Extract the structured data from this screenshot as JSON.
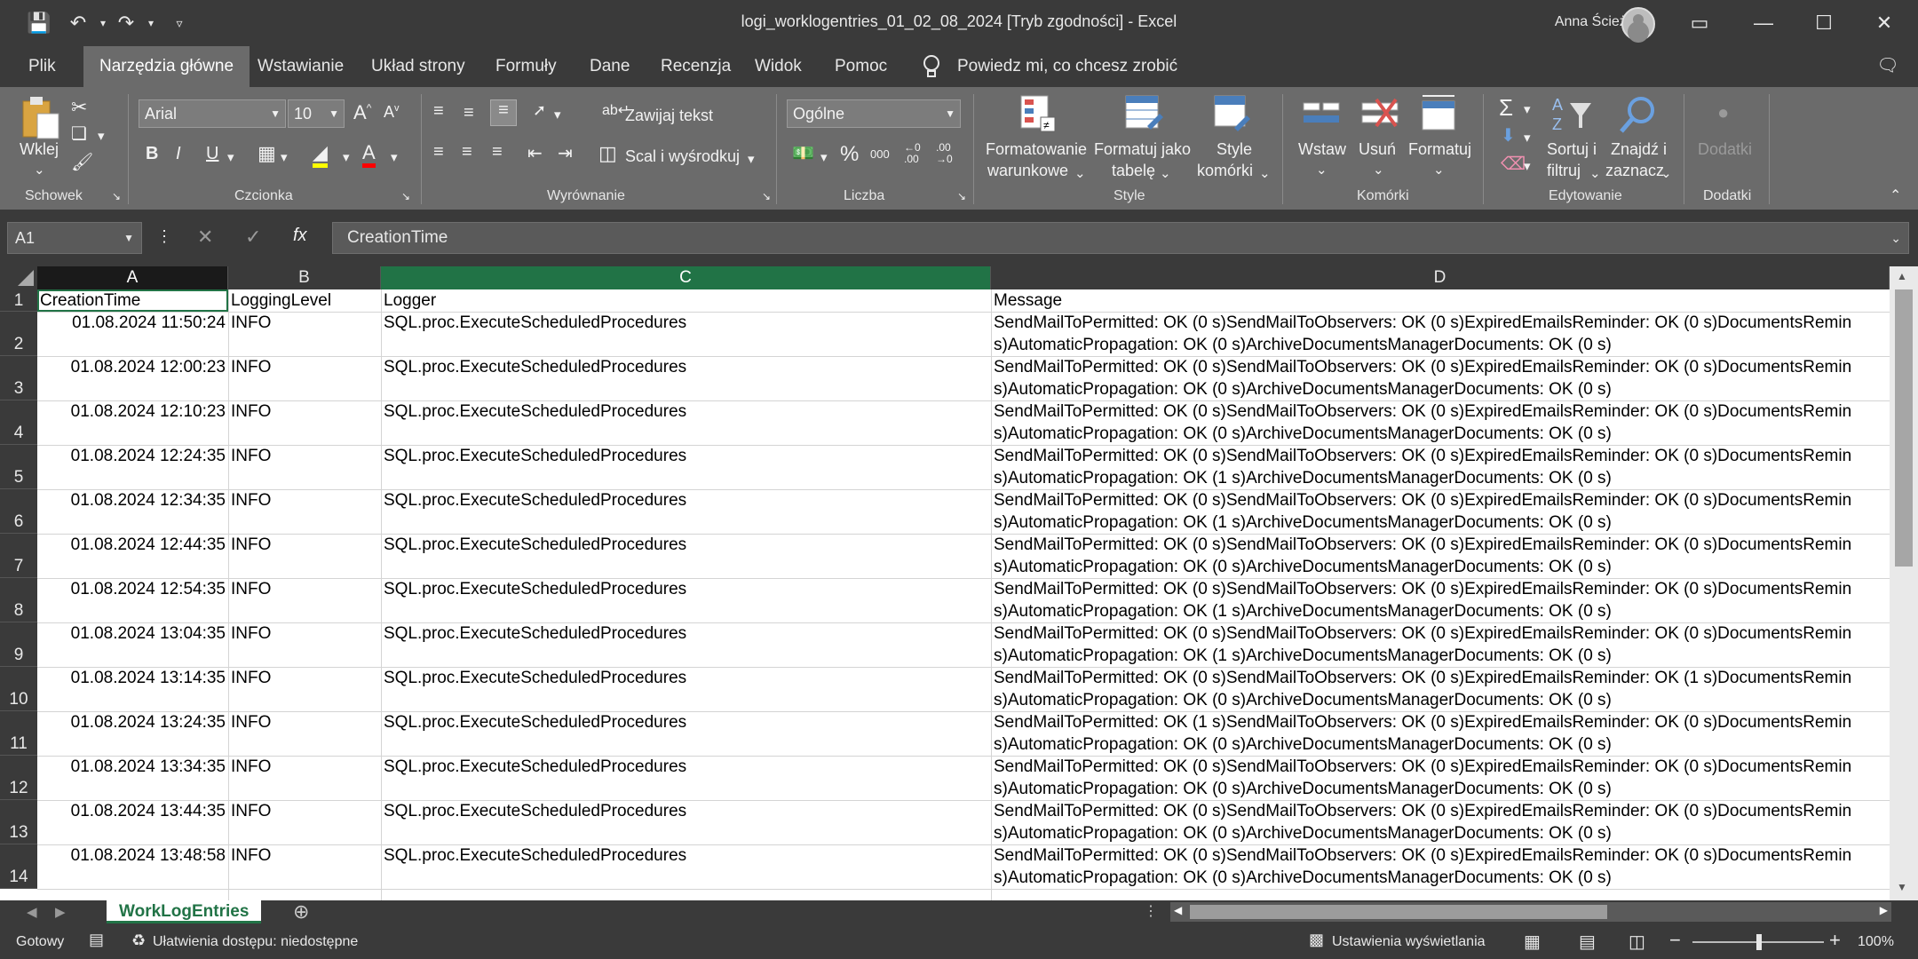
{
  "titlebar": {
    "title": "logi_worklogentries_01_02_08_2024  [Tryb zgodności]  -  Excel",
    "user": "Anna Ścieżor"
  },
  "tabs": [
    "Plik",
    "Narzędzia główne",
    "Wstawianie",
    "Układ strony",
    "Formuły",
    "Dane",
    "Recenzja",
    "Widok",
    "Pomoc"
  ],
  "tell_me": "Powiedz mi, co chcesz zrobić",
  "ribbon": {
    "clipboard": {
      "paste": "Wklej",
      "group": "Schowek"
    },
    "font": {
      "name": "Arial",
      "size": "10",
      "bold": "B",
      "italic": "I",
      "underline": "U",
      "group": "Czcionka"
    },
    "alignment": {
      "wrap": "Zawijaj tekst",
      "merge": "Scal i wyśrodkuj",
      "group": "Wyrównanie"
    },
    "number": {
      "format": "Ogólne",
      "group": "Liczba"
    },
    "styles": {
      "conditional_line1": "Formatowanie",
      "conditional_line2": "warunkowe",
      "table_line1": "Formatuj jako",
      "table_line2": "tabelę",
      "cell_line1": "Style",
      "cell_line2": "komórki",
      "group": "Style"
    },
    "cells": {
      "insert": "Wstaw",
      "delete": "Usuń",
      "format": "Formatuj",
      "group": "Komórki"
    },
    "editing": {
      "sort_line1": "Sortuj i",
      "sort_line2": "filtruj",
      "find_line1": "Znajdź i",
      "find_line2": "zaznacz",
      "group": "Edytowanie"
    },
    "addins": {
      "button": "Dodatki",
      "group": "Dodatki"
    }
  },
  "formula_bar": {
    "name_box": "A1",
    "content": "CreationTime"
  },
  "columns": [
    "A",
    "B",
    "C",
    "D"
  ],
  "header_row": [
    "CreationTime",
    "LoggingLevel",
    "Logger",
    "Message"
  ],
  "rows": [
    {
      "num": "2",
      "time": "01.08.2024 11:50:24",
      "level": "INFO",
      "logger": "SQL.proc.ExecuteScheduledProcedures",
      "msg1": "SendMailToPermitted: OK (0 s)SendMailToObservers: OK (0 s)ExpiredEmailsReminder: OK (0 s)DocumentsRemin",
      "msg2": "s)AutomaticPropagation: OK (0 s)ArchiveDocumentsManagerDocuments: OK (0 s)"
    },
    {
      "num": "3",
      "time": "01.08.2024 12:00:23",
      "level": "INFO",
      "logger": "SQL.proc.ExecuteScheduledProcedures",
      "msg1": "SendMailToPermitted: OK (0 s)SendMailToObservers: OK (0 s)ExpiredEmailsReminder: OK (0 s)DocumentsRemin",
      "msg2": "s)AutomaticPropagation: OK (0 s)ArchiveDocumentsManagerDocuments: OK (0 s)"
    },
    {
      "num": "4",
      "time": "01.08.2024 12:10:23",
      "level": "INFO",
      "logger": "SQL.proc.ExecuteScheduledProcedures",
      "msg1": "SendMailToPermitted: OK (0 s)SendMailToObservers: OK (0 s)ExpiredEmailsReminder: OK (0 s)DocumentsRemin",
      "msg2": "s)AutomaticPropagation: OK (0 s)ArchiveDocumentsManagerDocuments: OK (0 s)"
    },
    {
      "num": "5",
      "time": "01.08.2024 12:24:35",
      "level": "INFO",
      "logger": "SQL.proc.ExecuteScheduledProcedures",
      "msg1": "SendMailToPermitted: OK (0 s)SendMailToObservers: OK (0 s)ExpiredEmailsReminder: OK (0 s)DocumentsRemin",
      "msg2": "s)AutomaticPropagation: OK (1 s)ArchiveDocumentsManagerDocuments: OK (0 s)"
    },
    {
      "num": "6",
      "time": "01.08.2024 12:34:35",
      "level": "INFO",
      "logger": "SQL.proc.ExecuteScheduledProcedures",
      "msg1": "SendMailToPermitted: OK (0 s)SendMailToObservers: OK (0 s)ExpiredEmailsReminder: OK (0 s)DocumentsRemin",
      "msg2": "s)AutomaticPropagation: OK (1 s)ArchiveDocumentsManagerDocuments: OK (0 s)"
    },
    {
      "num": "7",
      "time": "01.08.2024 12:44:35",
      "level": "INFO",
      "logger": "SQL.proc.ExecuteScheduledProcedures",
      "msg1": "SendMailToPermitted: OK (0 s)SendMailToObservers: OK (0 s)ExpiredEmailsReminder: OK (0 s)DocumentsRemin",
      "msg2": "s)AutomaticPropagation: OK (0 s)ArchiveDocumentsManagerDocuments: OK (0 s)"
    },
    {
      "num": "8",
      "time": "01.08.2024 12:54:35",
      "level": "INFO",
      "logger": "SQL.proc.ExecuteScheduledProcedures",
      "msg1": "SendMailToPermitted: OK (0 s)SendMailToObservers: OK (0 s)ExpiredEmailsReminder: OK (0 s)DocumentsRemin",
      "msg2": "s)AutomaticPropagation: OK (1 s)ArchiveDocumentsManagerDocuments: OK (0 s)"
    },
    {
      "num": "9",
      "time": "01.08.2024 13:04:35",
      "level": "INFO",
      "logger": "SQL.proc.ExecuteScheduledProcedures",
      "msg1": "SendMailToPermitted: OK (0 s)SendMailToObservers: OK (0 s)ExpiredEmailsReminder: OK (0 s)DocumentsRemin",
      "msg2": "s)AutomaticPropagation: OK (1 s)ArchiveDocumentsManagerDocuments: OK (0 s)"
    },
    {
      "num": "10",
      "time": "01.08.2024 13:14:35",
      "level": "INFO",
      "logger": "SQL.proc.ExecuteScheduledProcedures",
      "msg1": "SendMailToPermitted: OK (0 s)SendMailToObservers: OK (0 s)ExpiredEmailsReminder: OK (1 s)DocumentsRemin",
      "msg2": "s)AutomaticPropagation: OK (0 s)ArchiveDocumentsManagerDocuments: OK (0 s)"
    },
    {
      "num": "11",
      "time": "01.08.2024 13:24:35",
      "level": "INFO",
      "logger": "SQL.proc.ExecuteScheduledProcedures",
      "msg1": "SendMailToPermitted: OK (1 s)SendMailToObservers: OK (0 s)ExpiredEmailsReminder: OK (0 s)DocumentsRemin",
      "msg2": "s)AutomaticPropagation: OK (0 s)ArchiveDocumentsManagerDocuments: OK (0 s)"
    },
    {
      "num": "12",
      "time": "01.08.2024 13:34:35",
      "level": "INFO",
      "logger": "SQL.proc.ExecuteScheduledProcedures",
      "msg1": "SendMailToPermitted: OK (0 s)SendMailToObservers: OK (0 s)ExpiredEmailsReminder: OK (0 s)DocumentsRemin",
      "msg2": "s)AutomaticPropagation: OK (0 s)ArchiveDocumentsManagerDocuments: OK (0 s)"
    },
    {
      "num": "13",
      "time": "01.08.2024 13:44:35",
      "level": "INFO",
      "logger": "SQL.proc.ExecuteScheduledProcedures",
      "msg1": "SendMailToPermitted: OK (0 s)SendMailToObservers: OK (0 s)ExpiredEmailsReminder: OK (0 s)DocumentsRemin",
      "msg2": "s)AutomaticPropagation: OK (0 s)ArchiveDocumentsManagerDocuments: OK (0 s)"
    },
    {
      "num": "14",
      "time": "01.08.2024 13:48:58",
      "level": "INFO",
      "logger": "SQL.proc.ExecuteScheduledProcedures",
      "msg1": "SendMailToPermitted: OK (0 s)SendMailToObservers: OK (0 s)ExpiredEmailsReminder: OK (0 s)DocumentsRemin",
      "msg2": "s)AutomaticPropagation: OK (0 s)ArchiveDocumentsManagerDocuments: OK (0 s)"
    }
  ],
  "sheet_tab": "WorkLogEntries",
  "status": {
    "ready": "Gotowy",
    "accessibility": "Ułatwienia dostępu: niedostępne",
    "display_settings": "Ustawienia wyświetlania",
    "zoom": "100%"
  },
  "colors": {
    "accent": "#217346",
    "ribbon": "#6b6b6b",
    "chrome": "#3a3a3a"
  }
}
